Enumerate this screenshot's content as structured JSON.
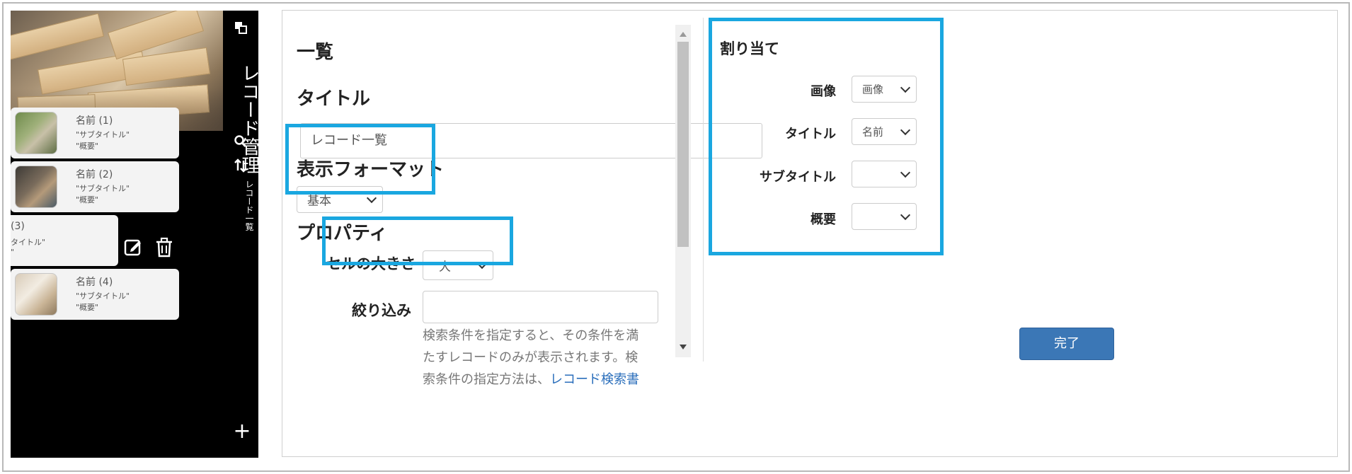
{
  "preview": {
    "app_title": "レコード管理",
    "app_subtitle": "レコード一覧",
    "rail_icons": [
      "window-icon",
      "search-icon",
      "sort-icon"
    ],
    "records": [
      {
        "name": "名前 (1)",
        "subtitle": "\"サブタイトル\"",
        "summary": "\"概要\""
      },
      {
        "name": "名前 (2)",
        "subtitle": "\"サブタイトル\"",
        "summary": "\"概要\""
      },
      {
        "name": "(3)",
        "subtitle": "タイトル\"",
        "summary": "\""
      },
      {
        "name": "名前 (4)",
        "subtitle": "\"サブタイトル\"",
        "summary": "\"概要\""
      }
    ],
    "swipe_actions": [
      "edit-icon",
      "trash-icon"
    ],
    "add_label": "+"
  },
  "settings": {
    "list_heading": "一覧",
    "title_heading": "タイトル",
    "title_value": "レコード一覧",
    "format_heading": "表示フォーマット",
    "format_value": "基本",
    "properties_heading": "プロパティ",
    "cell_size_label": "セルの大きさ",
    "cell_size_value": "大",
    "filter_label": "絞り込み",
    "filter_value": "",
    "help_line1": "検索条件を指定すると、その条件を満",
    "help_line2": "たすレコードのみが表示されます。検",
    "help_line3_pre": "索条件の指定方法は、",
    "help_line3_link": "レコード検索書"
  },
  "assignment": {
    "heading": "割り当て",
    "rows": [
      {
        "label": "画像",
        "value": "画像"
      },
      {
        "label": "タイトル",
        "value": "名前"
      },
      {
        "label": "サブタイトル",
        "value": ""
      },
      {
        "label": "概要",
        "value": ""
      }
    ]
  },
  "footer": {
    "done_label": "完了"
  },
  "colors": {
    "highlight": "#1aa7e0",
    "primary_button": "#3b77b6"
  }
}
